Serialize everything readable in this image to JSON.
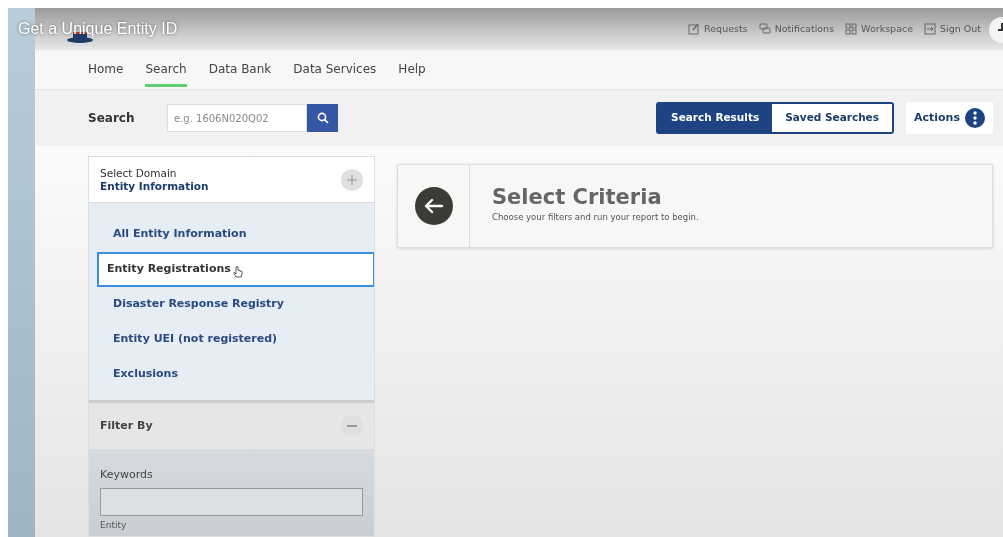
{
  "video": {
    "title": "Get a Unique Entity ID"
  },
  "header": {
    "links": [
      {
        "label": "Requests",
        "kind": "edit"
      },
      {
        "label": "Notifications",
        "kind": "chat"
      },
      {
        "label": "Workspace",
        "kind": "grid"
      },
      {
        "label": "Sign Out",
        "kind": "exit"
      }
    ]
  },
  "nav": [
    {
      "label": "Home",
      "selected": false
    },
    {
      "label": "Search",
      "selected": true
    },
    {
      "label": "Data Bank",
      "selected": false
    },
    {
      "label": "Data Services",
      "selected": false
    },
    {
      "label": "Help",
      "selected": false
    }
  ],
  "search": {
    "label": "Search",
    "placeholder": "e.g. 1606N020Q02"
  },
  "view_toggle": [
    {
      "label": "Search Results",
      "selected": true
    },
    {
      "label": "Saved Searches",
      "selected": false
    }
  ],
  "actions": {
    "label": "Actions"
  },
  "domain": {
    "heading": "Select Domain",
    "value": "Entity Information"
  },
  "domain_items": [
    {
      "label": "All Entity Information",
      "selected": false
    },
    {
      "label": "Entity Registrations",
      "selected": true
    },
    {
      "label": "Disaster Response Registry",
      "selected": false
    },
    {
      "label": "Entity UEI (not registered)",
      "selected": false
    },
    {
      "label": "Exclusions",
      "selected": false
    }
  ],
  "filter": {
    "heading": "Filter By",
    "expanded": true,
    "keywords_label": "Keywords",
    "next_label": "Entity"
  },
  "criteria": {
    "title": "Select Criteria",
    "subtitle": "Choose your filters and run your report to begin."
  }
}
